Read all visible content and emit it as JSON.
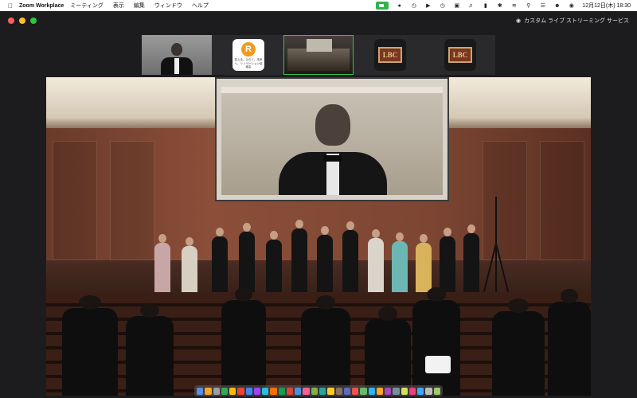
{
  "menubar": {
    "app_name": "Zoom Workplace",
    "menus": [
      "ミーティング",
      "表示",
      "編集",
      "ウィンドウ",
      "ヘルプ"
    ],
    "clock": "12月12日(木)  18:30",
    "status_icons": [
      "zoom-status-icon",
      "share-icon",
      "timer-icon",
      "play-icon",
      "clock-icon",
      "a-icon",
      "volume-icon",
      "battery-icon",
      "bluetooth-icon",
      "wifi-icon",
      "search-icon",
      "control-center-icon",
      "user-icon",
      "siri-icon"
    ]
  },
  "window": {
    "stream_label": "カスタム ライブ ストリーミング サービス"
  },
  "thumbnails": {
    "logo_r": {
      "letter": "R",
      "caption": "変える。ひらく。未来へ。リノベーション協議会"
    },
    "lbc_label": "LBC"
  },
  "dock": {
    "icon_colors": [
      "#5b8def",
      "#f5a623",
      "#9aa0a6",
      "#34a853",
      "#fbbc05",
      "#ea4335",
      "#4285f4",
      "#a142f4",
      "#24c1e0",
      "#ff6d00",
      "#0f9d58",
      "#db4437",
      "#4a90e2",
      "#f06292",
      "#7cb342",
      "#26a69a",
      "#ffca28",
      "#8d6e63",
      "#5c6bc0",
      "#ef5350",
      "#66bb6a",
      "#29b6f6",
      "#ffa726",
      "#ab47bc",
      "#78909c",
      "#d4e157",
      "#ec407a",
      "#42a5f5",
      "#bdbdbd",
      "#9ccc65"
    ]
  },
  "colors": {
    "active_thumb_border": "#35c24f",
    "zoom_status": "#2fb44b"
  }
}
